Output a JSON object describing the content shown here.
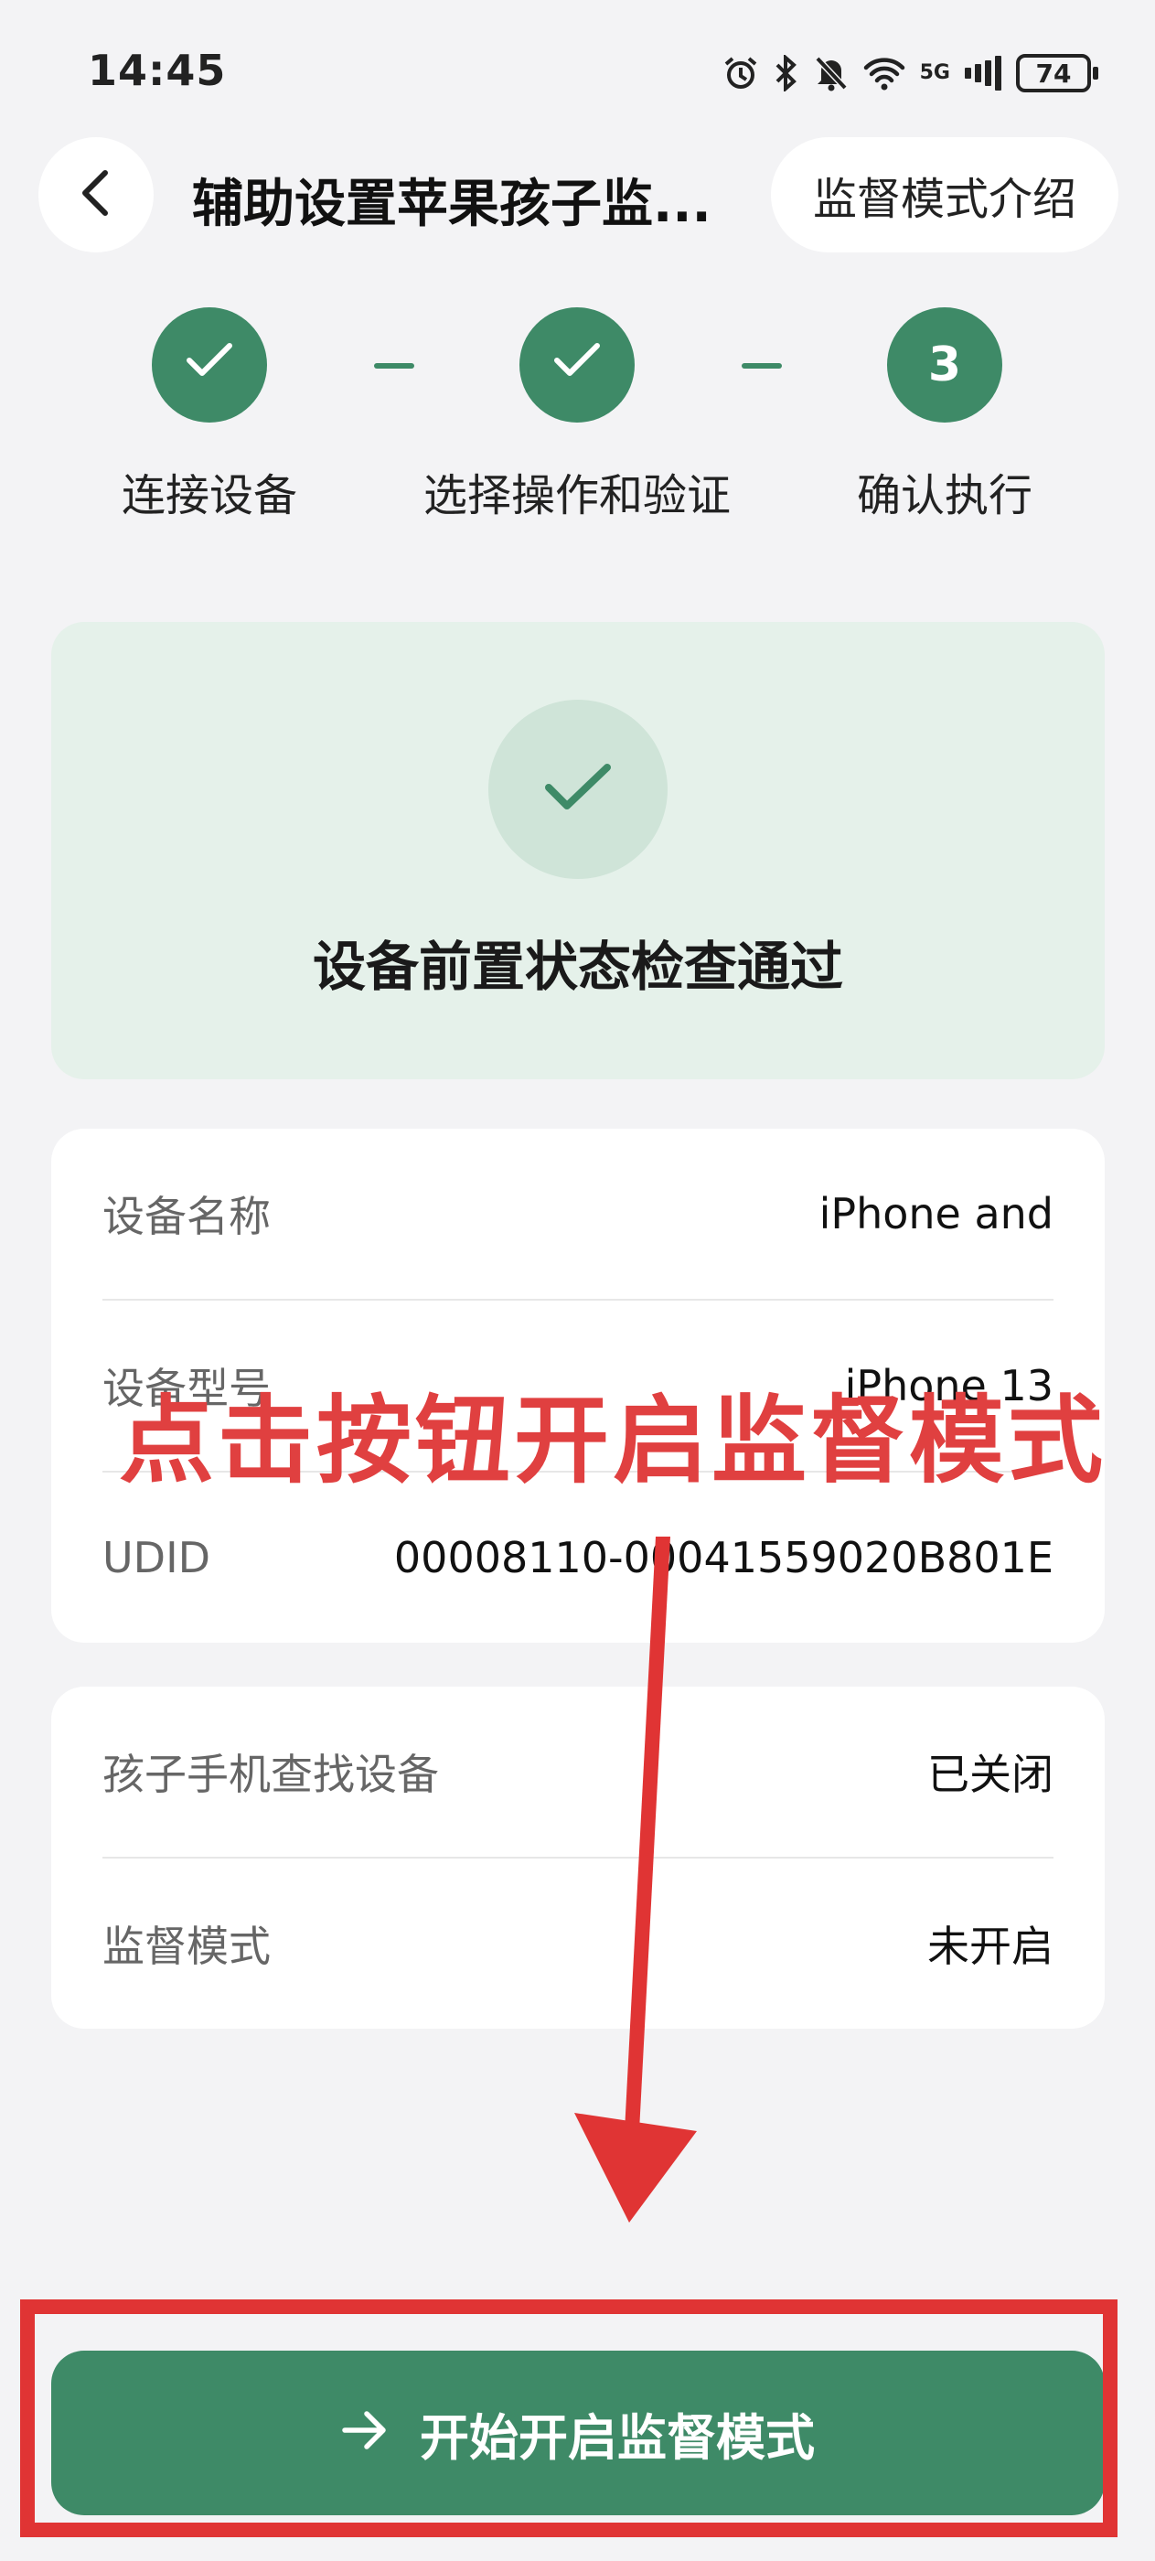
{
  "status_bar": {
    "time": "14:45",
    "network_label": "5G",
    "battery": "74",
    "icons": [
      "alarm-icon",
      "bluetooth-icon",
      "mute-icon",
      "wifi-icon",
      "signal-icon",
      "battery-icon"
    ]
  },
  "header": {
    "back_icon": "chevron-left-icon",
    "title": "辅助设置苹果孩子监...",
    "intro_button": "监督模式介绍"
  },
  "steps": [
    {
      "label": "连接设备",
      "state": "done",
      "icon": "check-icon"
    },
    {
      "label": "选择操作和验证",
      "state": "done",
      "icon": "check-icon"
    },
    {
      "label": "确认执行",
      "state": "current",
      "number": "3"
    }
  ],
  "success": {
    "icon": "check-icon",
    "text": "设备前置状态检查通过"
  },
  "device_info": [
    {
      "label": "设备名称",
      "value": "iPhone and"
    },
    {
      "label": "设备型号",
      "value": "iPhone 13"
    },
    {
      "label": "UDID",
      "value": "00008110-00041559020B801E"
    }
  ],
  "status_info": [
    {
      "label": "孩子手机查找设备",
      "value": "已关闭"
    },
    {
      "label": "监督模式",
      "value": "未开启"
    }
  ],
  "annotation": {
    "text": "点击按钮开启监督模式",
    "color": "#e04040"
  },
  "start_button": {
    "icon": "arrow-right-icon",
    "label": "开始开启监督模式"
  },
  "colors": {
    "accent": "#3e8a67",
    "success_bg": "#e5f1ea",
    "annotation_red": "#e03434"
  }
}
